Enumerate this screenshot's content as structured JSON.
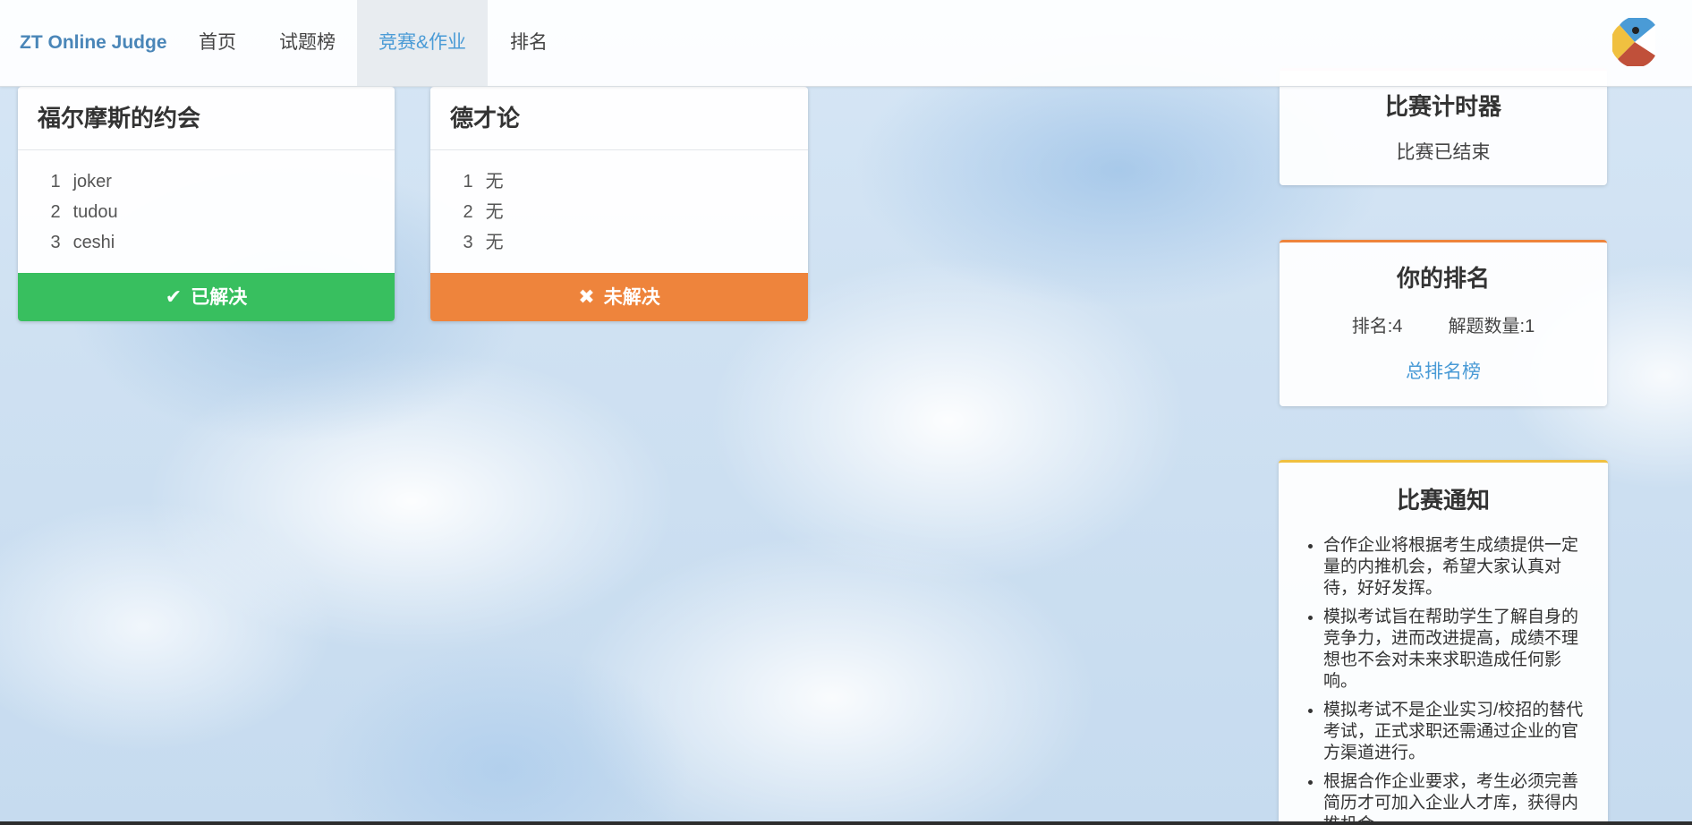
{
  "nav": {
    "brand": "ZT Online Judge",
    "items": [
      {
        "label": "首页",
        "active": false
      },
      {
        "label": "试题榜",
        "active": false
      },
      {
        "label": "竞赛&作业",
        "active": true
      },
      {
        "label": "排名",
        "active": false
      }
    ],
    "avatar_icon": "pacman-avatar-icon"
  },
  "problems": [
    {
      "title": "福尔摩斯的约会",
      "ranking": [
        {
          "rank": "1",
          "name": "joker"
        },
        {
          "rank": "2",
          "name": "tudou"
        },
        {
          "rank": "3",
          "name": "ceshi"
        }
      ],
      "status_label": "已解决",
      "status_icon": "check-icon",
      "status_color": "#38bf5f"
    },
    {
      "title": "德才论",
      "ranking": [
        {
          "rank": "1",
          "name": "无"
        },
        {
          "rank": "2",
          "name": "无"
        },
        {
          "rank": "3",
          "name": "无"
        }
      ],
      "status_label": "未解决",
      "status_icon": "cross-icon",
      "status_color": "#ee843c"
    }
  ],
  "timer": {
    "title": "比赛计时器",
    "text": "比赛已结束",
    "accent": "#f5c6e0"
  },
  "my_rank": {
    "title": "你的排名",
    "rank_label": "排名:4",
    "solved_label": "解题数量:1",
    "link_label": "总排名榜",
    "accent": "#ee843c"
  },
  "notice": {
    "title": "比赛通知",
    "accent": "#f0c040",
    "items": [
      "合作企业将根据考生成绩提供一定量的内推机会，希望大家认真对待，好好发挥。",
      "模拟考试旨在帮助学生了解自身的竞争力，进而改进提高，成绩不理想也不会对未来求职造成任何影响。",
      "模拟考试不是企业实习/校招的替代考试，正式求职还需通过企业的官方渠道进行。",
      "根据合作企业要求，考生必须完善简历才可加入企业人才库，获得内推机会。"
    ]
  }
}
